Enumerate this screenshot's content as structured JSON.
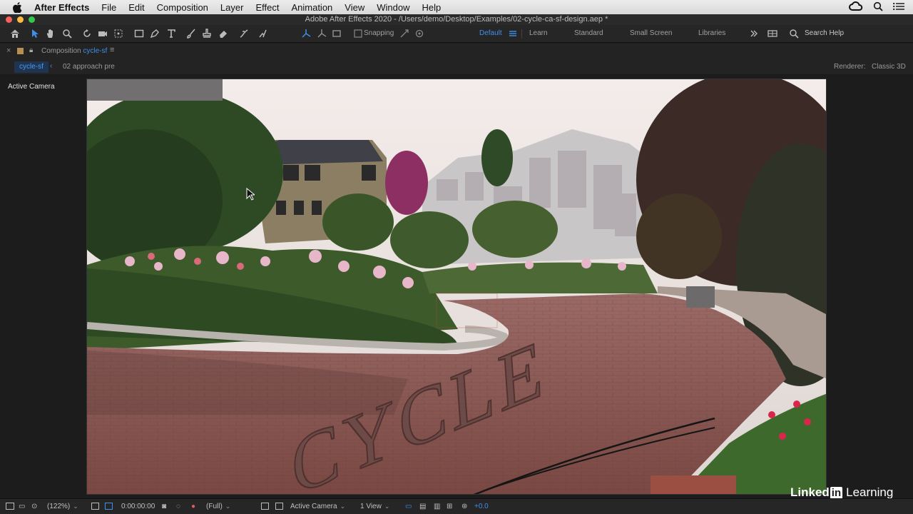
{
  "menubar": {
    "app_name": "After Effects",
    "items": [
      "File",
      "Edit",
      "Composition",
      "Layer",
      "Effect",
      "Animation",
      "View",
      "Window",
      "Help"
    ]
  },
  "titlebar": {
    "title": "Adobe After Effects 2020 - /Users/demo/Desktop/Examples/02-cycle-ca-sf-design.aep *"
  },
  "toolbar": {
    "snapping_label": "Snapping",
    "workspaces": [
      "Default",
      "Learn",
      "Standard",
      "Small Screen",
      "Libraries"
    ],
    "active_workspace": "Default",
    "search_label": "Search Help",
    "accent_color": "#3f8fe8"
  },
  "comp_panel": {
    "title_prefix": "Composition",
    "comp_name": "cycle-sf",
    "tabs": [
      "cycle-sf",
      "02 approach pre"
    ],
    "renderer_label": "Renderer:",
    "renderer_value": "Classic 3D",
    "view_label": "Active Camera"
  },
  "viewer": {
    "text_layer": "CYCLE"
  },
  "bottombar": {
    "zoom": "(122%)",
    "timecode": "0:00:00:00",
    "resolution": "(Full)",
    "camera": "Active Camera",
    "views": "1 View",
    "exposure": "+0.0"
  },
  "watermark": {
    "brand": "LinkedIn Learning",
    "brand_linked": "Linked",
    "brand_in": "in",
    "brand_learning": "Learning"
  }
}
